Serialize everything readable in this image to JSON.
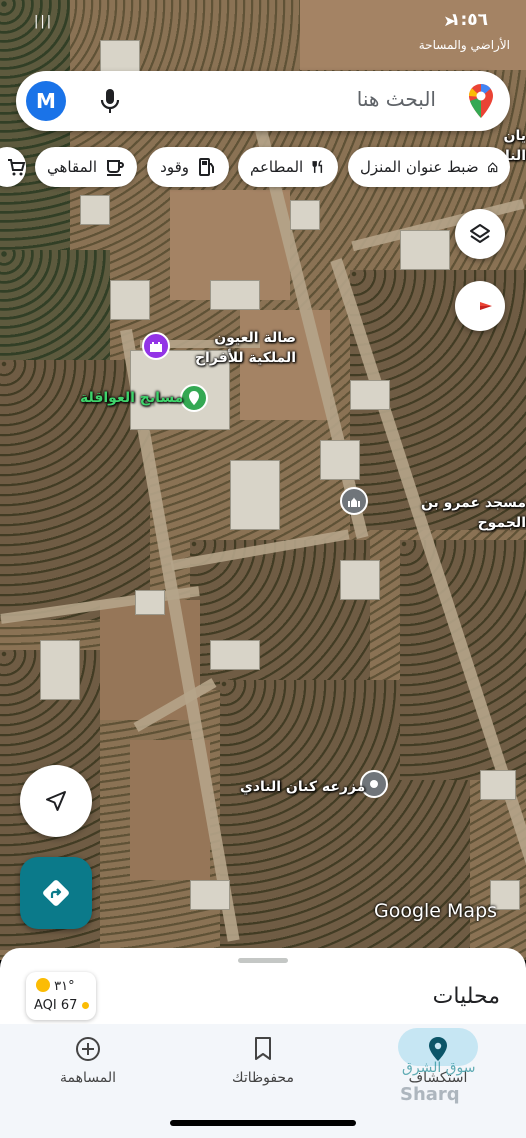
{
  "status_bar": {
    "time": "١:٥٦",
    "location_arrow": "➤",
    "signal_text": "|||",
    "subtitle": "الأراضي والمساحة"
  },
  "search": {
    "avatar_letter": "M",
    "placeholder": "البحث هنا",
    "mic_icon": "mic-icon",
    "logo_icon": "google-maps-pin-icon"
  },
  "chips": [
    {
      "label": "ضبط عنوان المنزل",
      "icon": "home-icon"
    },
    {
      "label": "المطاعم",
      "icon": "restaurant-icon"
    },
    {
      "label": "وقود",
      "icon": "fuel-icon"
    },
    {
      "label": "المقاهي",
      "icon": "coffee-icon"
    }
  ],
  "map": {
    "partial_label": "يان النادي",
    "places": [
      {
        "name": "صالة العيون الملكية للأفراح",
        "icon": "castle-icon"
      },
      {
        "name": "مسابح العواقلة",
        "icon": "pool-icon"
      },
      {
        "name": "مسجد عمرو بن الجموح",
        "icon": "mosque-icon"
      },
      {
        "name": "مزرعه كنان النادي",
        "icon": "pin-icon"
      }
    ],
    "logo_text": "Google Maps"
  },
  "sheet": {
    "weather_temp": "٣١°",
    "weather_aqi": "AQI 67",
    "title": "محليات"
  },
  "bottom_nav": [
    {
      "label": "استكشاف",
      "icon": "explore-pin-icon",
      "active": true
    },
    {
      "label": "محفوظاتك",
      "icon": "bookmark-icon",
      "active": false
    },
    {
      "label": "المساهمة",
      "icon": "add-circle-icon",
      "active": false
    }
  ],
  "watermark": {
    "arabic": "سوق الشرق",
    "latin": "Sharq"
  },
  "colors": {
    "accent": "#1a73e8",
    "nav_button": "#0b7a8a",
    "green_place": "#34a853",
    "purple_place": "#9334e6",
    "gray_place": "#70757a"
  }
}
